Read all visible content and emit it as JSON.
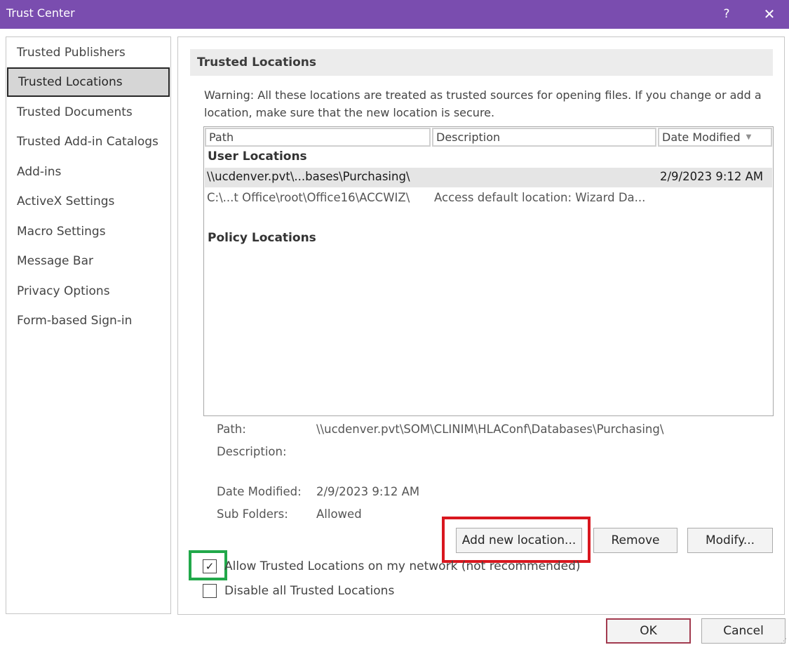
{
  "window": {
    "title": "Trust Center",
    "help_label": "?",
    "close_label": "✕"
  },
  "sidebar": {
    "items": [
      {
        "label": "Trusted Publishers"
      },
      {
        "label": "Trusted Locations"
      },
      {
        "label": "Trusted Documents"
      },
      {
        "label": "Trusted Add-in Catalogs"
      },
      {
        "label": "Add-ins"
      },
      {
        "label": "ActiveX Settings"
      },
      {
        "label": "Macro Settings"
      },
      {
        "label": "Message Bar"
      },
      {
        "label": "Privacy Options"
      },
      {
        "label": "Form-based Sign-in"
      }
    ],
    "selected": "Trusted Locations"
  },
  "main": {
    "header": "Trusted Locations",
    "warning": "Warning: All these locations are treated as trusted sources for opening files.  If you change or add a location, make sure that the new location is secure.",
    "table": {
      "columns": [
        "Path",
        "Description",
        "Date Modified"
      ],
      "sort_indicator": "▼",
      "groups": {
        "user": "User Locations",
        "policy": "Policy Locations"
      },
      "user_rows": [
        {
          "path": "\\\\ucdenver.pvt\\...bases\\Purchasing\\",
          "description": "",
          "date": "2/9/2023 9:12 AM"
        },
        {
          "path": "C:\\...t Office\\root\\Office16\\ACCWIZ\\",
          "description": "Access default location: Wizard Da...",
          "date": ""
        }
      ]
    },
    "details": {
      "path_label": "Path:",
      "path_value": "\\\\ucdenver.pvt\\SOM\\CLINIM\\HLAConf\\Databases\\Purchasing\\",
      "description_label": "Description:",
      "description_value": "",
      "date_label": "Date Modified:",
      "date_value": "2/9/2023 9:12 AM",
      "subfolders_label": "Sub Folders:",
      "subfolders_value": "Allowed"
    },
    "buttons": {
      "add": "Add new location...",
      "remove": "Remove",
      "modify": "Modify..."
    },
    "checkboxes": {
      "allow_network": {
        "label": "Allow Trusted Locations on my network (not recommended)",
        "checked": true
      },
      "disable_all": {
        "label": "Disable all Trusted Locations",
        "checked": false
      }
    }
  },
  "footer": {
    "ok": "OK",
    "cancel": "Cancel"
  },
  "colors": {
    "titlebar": "#7a4daf",
    "highlight_red": "#d9171f",
    "highlight_green": "#21a84a",
    "ok_border": "#a23b4f"
  }
}
